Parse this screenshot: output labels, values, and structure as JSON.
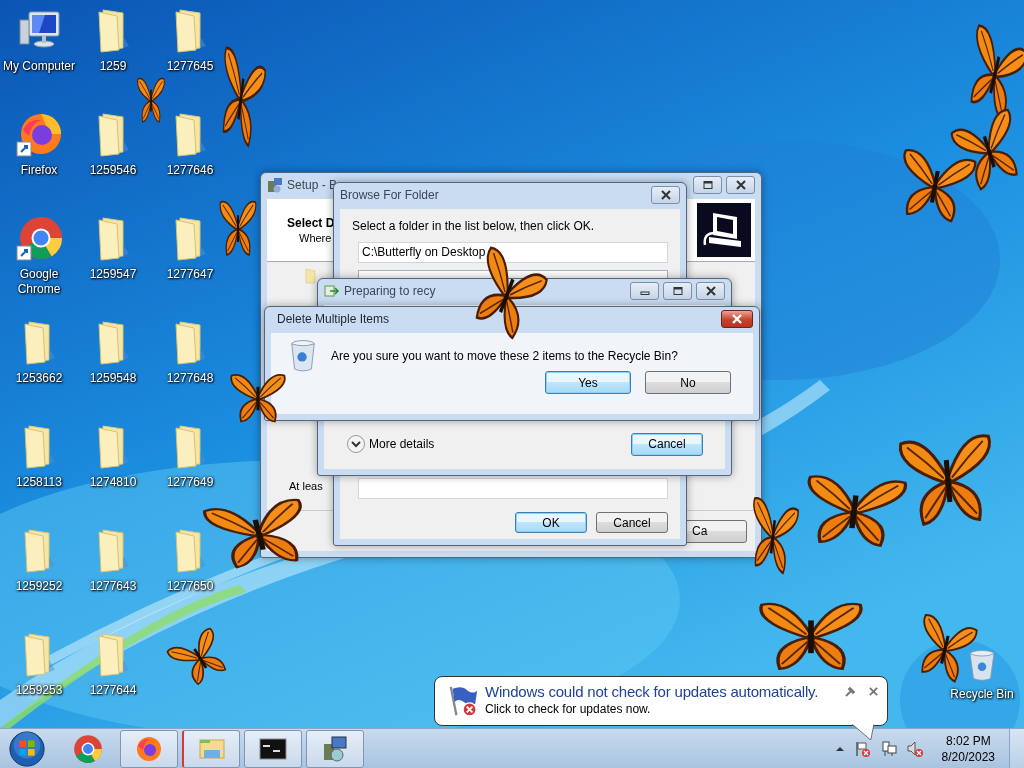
{
  "desktop_icons": [
    {
      "label": "My Computer",
      "kind": "computer"
    },
    {
      "label": "Firefox",
      "kind": "firefox"
    },
    {
      "label": "Google Chrome",
      "kind": "chrome"
    },
    {
      "label": "1253662",
      "kind": "folder"
    },
    {
      "label": "1258113",
      "kind": "folder"
    },
    {
      "label": "1259252",
      "kind": "folder"
    },
    {
      "label": "1259253",
      "kind": "folder"
    },
    {
      "label": "1259",
      "kind": "folder"
    },
    {
      "label": "1259546",
      "kind": "folder"
    },
    {
      "label": "1259547",
      "kind": "folder"
    },
    {
      "label": "1259548",
      "kind": "folder"
    },
    {
      "label": "1274810",
      "kind": "folder"
    },
    {
      "label": "1277643",
      "kind": "folder"
    },
    {
      "label": "1277644",
      "kind": "folder"
    },
    {
      "label": "1277645",
      "kind": "folder"
    },
    {
      "label": "1277646",
      "kind": "folder"
    },
    {
      "label": "1277647",
      "kind": "folder"
    },
    {
      "label": "1277648",
      "kind": "folder"
    },
    {
      "label": "1277649",
      "kind": "folder"
    },
    {
      "label": "1277650",
      "kind": "folder"
    }
  ],
  "recycle_bin": {
    "label": "Recycle Bin"
  },
  "setup_window": {
    "title": "Setup - B",
    "heading": "Select D",
    "subheading": "Where",
    "note": "At leas",
    "button": "Ca"
  },
  "browse_window": {
    "title": "Browse For Folder",
    "instruction": "Select a folder in the list below, then click OK.",
    "path": "C:\\Butterfly on Desktop",
    "buttons": [
      {
        "label": "OK",
        "default": true
      },
      {
        "label": "Cancel",
        "default": false
      }
    ]
  },
  "progress_window": {
    "title": "Preparing to recy",
    "details": "More details",
    "button": {
      "label": "Cancel",
      "default": true
    }
  },
  "delete_dialog": {
    "title": "Delete Multiple Items",
    "message": "Are you sure you want to move these 2 items to the Recycle Bin?",
    "buttons": [
      {
        "label": "Yes",
        "default": true
      },
      {
        "label": "No",
        "default": false
      }
    ]
  },
  "balloon": {
    "title": "Windows could not check for updates automatically.",
    "text": "Click to check for updates now."
  },
  "tray": {
    "time": "8:02 PM",
    "date": "8/20/2023"
  }
}
